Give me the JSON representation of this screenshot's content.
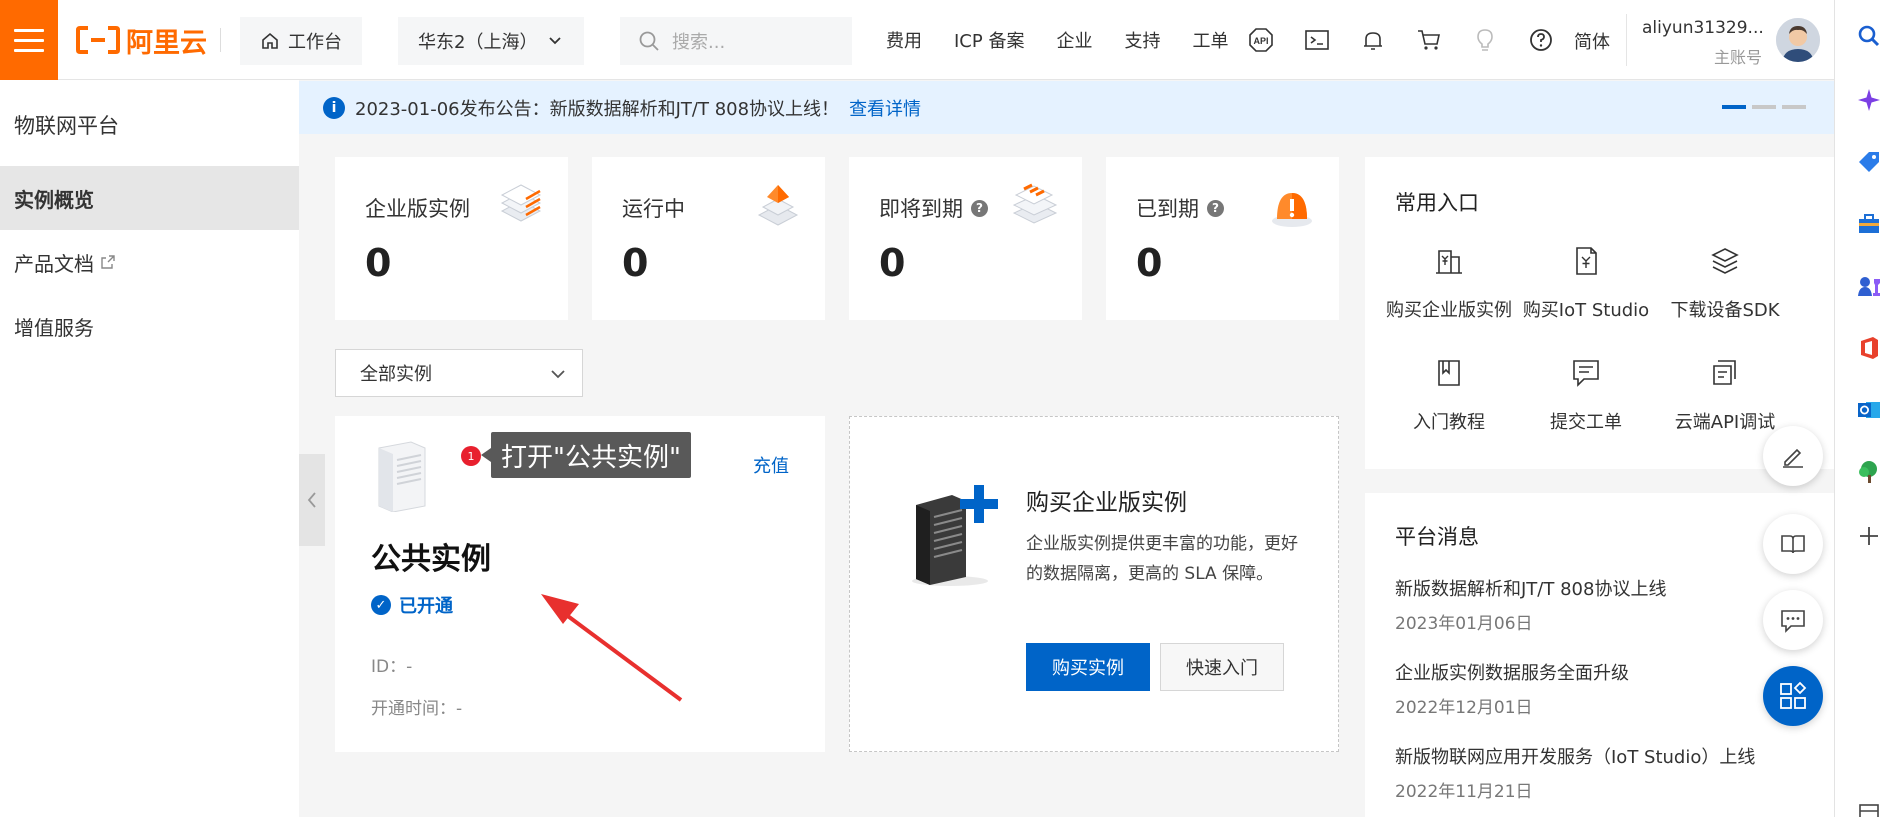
{
  "header": {
    "logo_text": "阿里云",
    "workbench_label": "工作台",
    "region_label": "华东2（上海）",
    "search_placeholder": "搜索...",
    "links": [
      "费用",
      "ICP 备案",
      "企业",
      "支持",
      "工单"
    ],
    "api_icon_text": "API",
    "lang_label": "简体",
    "user_name": "aliyun31329...",
    "user_role": "主账号"
  },
  "sidebar": {
    "title": "物联网平台",
    "items": [
      {
        "label": "实例概览",
        "active": true
      },
      {
        "label": "产品文档",
        "external": true
      },
      {
        "label": "增值服务"
      }
    ]
  },
  "notice": {
    "text": "2023-01-06发布公告：新版数据解析和JT/T 808协议上线！",
    "link": "查看详情"
  },
  "stats": [
    {
      "label": "企业版实例",
      "value": "0",
      "help": false
    },
    {
      "label": "运行中",
      "value": "0",
      "help": false
    },
    {
      "label": "即将到期",
      "value": "0",
      "help": true
    },
    {
      "label": "已到期",
      "value": "0",
      "help": true
    }
  ],
  "filter": {
    "selected": "全部实例"
  },
  "public_instance": {
    "badge": "1",
    "tooltip": "打开\"公共实例\"",
    "recharge": "充值",
    "name": "公共实例",
    "status": "已开通",
    "id_label": "ID：-",
    "time_label": "开通时间：-"
  },
  "buy_card": {
    "title": "购买企业版实例",
    "description": "企业版实例提供更丰富的功能，更好的数据隔离，更高的 SLA 保障。",
    "primary_button": "购买实例",
    "secondary_button": "快速入门"
  },
  "quick_entry": {
    "title": "常用入口",
    "items": [
      {
        "label": "购买企业版实例",
        "icon": "building-yen-icon"
      },
      {
        "label": "购买IoT Studio",
        "icon": "document-yen-icon"
      },
      {
        "label": "下载设备SDK",
        "icon": "layers-icon"
      },
      {
        "label": "入门教程",
        "icon": "book-icon"
      },
      {
        "label": "提交工单",
        "icon": "chat-doc-icon"
      },
      {
        "label": "云端API调试",
        "icon": "api-debug-icon"
      }
    ]
  },
  "platform_messages": {
    "title": "平台消息",
    "items": [
      {
        "title": "新版数据解析和JT/T 808协议上线",
        "date": "2023年01月06日"
      },
      {
        "title": "企业版实例数据服务全面升级",
        "date": "2022年12月01日"
      },
      {
        "title": "新版物联网应用开发服务（IoT Studio）上线",
        "date": "2022年11月21日"
      }
    ]
  },
  "colors": {
    "brand": "#ff6a00",
    "primary": "#0064c8",
    "notice_bg": "#e5f2ff",
    "badge_red": "#e8202e"
  }
}
